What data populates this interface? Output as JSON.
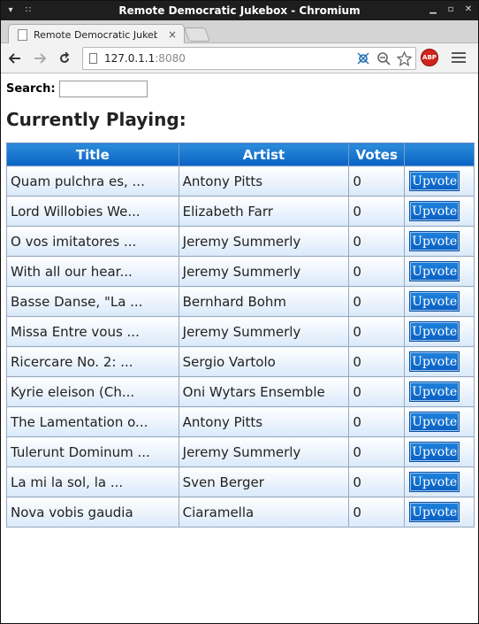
{
  "window": {
    "title": "Remote Democratic Jukebox - Chromium"
  },
  "tab": {
    "title": "Remote Democratic Jukeb",
    "close_glyph": "×"
  },
  "toolbar": {
    "url_host": "127.0.1.1",
    "url_port": ":8080",
    "abp_label": "ABP"
  },
  "search": {
    "label": "Search:",
    "value": "",
    "placeholder": ""
  },
  "heading": "Currently Playing:",
  "table": {
    "headers": [
      "Title",
      "Artist",
      "Votes",
      ""
    ],
    "button_label": "Upvote",
    "rows": [
      {
        "title": "Quam pulchra es, ...",
        "artist": "Antony Pitts",
        "votes": "0"
      },
      {
        "title": "Lord Willobies We...",
        "artist": "Elizabeth Farr",
        "votes": "0"
      },
      {
        "title": "O vos imitatores ...",
        "artist": "Jeremy Summerly",
        "votes": "0"
      },
      {
        "title": "With all our hear...",
        "artist": "Jeremy Summerly",
        "votes": "0"
      },
      {
        "title": "Basse Danse, \"La ...",
        "artist": "Bernhard Bohm",
        "votes": "0"
      },
      {
        "title": "Missa Entre vous ...",
        "artist": "Jeremy Summerly",
        "votes": "0"
      },
      {
        "title": "Ricercare No. 2: ...",
        "artist": "Sergio Vartolo",
        "votes": "0"
      },
      {
        "title": "Kyrie eleison (Ch...",
        "artist": "Oni Wytars Ensemble",
        "votes": "0"
      },
      {
        "title": "The Lamentation o...",
        "artist": "Antony Pitts",
        "votes": "0"
      },
      {
        "title": "Tulerunt Dominum ...",
        "artist": "Jeremy Summerly",
        "votes": "0"
      },
      {
        "title": "La mi la sol, la ...",
        "artist": "Sven Berger",
        "votes": "0"
      },
      {
        "title": "Nova vobis gaudia",
        "artist": "Ciaramella",
        "votes": "0"
      }
    ]
  },
  "colors": {
    "header_blue": "#0a62c4",
    "button_blue": "#0a5fc2",
    "abp_red": "#d0251b"
  },
  "icons": [
    "page-icon",
    "back-arrow-icon",
    "forward-arrow-icon",
    "reload-icon",
    "network-icon",
    "zoom-icon",
    "star-icon",
    "adblock-icon",
    "menu-icon"
  ]
}
